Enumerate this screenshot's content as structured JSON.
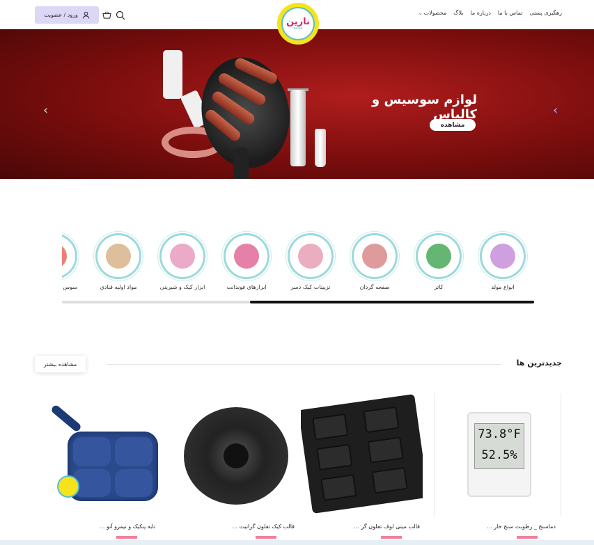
{
  "header": {
    "login_label": "ورود / عضویت",
    "logo_text": "نارین",
    "logo_sub": "NARIN",
    "nav": [
      {
        "label": "محصولات",
        "has_dropdown": true
      },
      {
        "label": "بلاگ"
      },
      {
        "label": "درباره ما"
      },
      {
        "label": "تماس با ما"
      },
      {
        "label": "رهگیری پستی"
      }
    ]
  },
  "hero": {
    "title": "لوازم سوسیس و کالباس",
    "button_label": "مشاهده",
    "prev_arrow": "‹",
    "next_arrow": "‹"
  },
  "categories": [
    {
      "label": "انواع مولد",
      "color": "#c78fd9"
    },
    {
      "label": "کاتر",
      "color": "#4aa85a"
    },
    {
      "label": "صفحه گردان",
      "color": "#d98a8a"
    },
    {
      "label": "تزیینات کیک دسر",
      "color": "#e7a0b5"
    },
    {
      "label": "ابزارهای فوندانت",
      "color": "#e06a9a"
    },
    {
      "label": "ابزار کیک و شیرینی",
      "color": "#e79bbd"
    },
    {
      "label": "مواد اولیه قنادی",
      "color": "#d8b48a"
    },
    {
      "label": "سوس",
      "color": "#e86b5f"
    }
  ],
  "newest": {
    "title": "جدیدترین ها",
    "more_label": "مشاهده بیشتر",
    "products": [
      {
        "name": "دماسنج _ رطوبت سنج خار ...",
        "display_top": "73.8°F",
        "display_bottom": "52.5%"
      },
      {
        "name": "قالب مینی لوف تفلون گر ..."
      },
      {
        "name": "قالب کیک تفلون گرانیت ..."
      },
      {
        "name": "تابه پنکیک و نیمرو آنو ..."
      }
    ]
  },
  "colors": {
    "accent": "#dcd6f7",
    "hero_bg": "#8a1212",
    "price": "#e92b5a"
  }
}
